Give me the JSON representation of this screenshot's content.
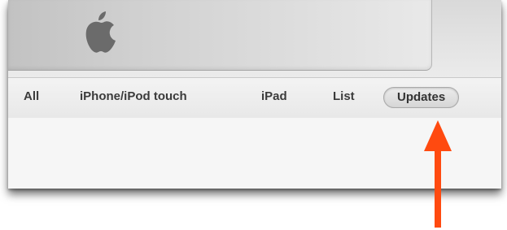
{
  "header": {
    "logo_icon": "apple-logo-icon"
  },
  "tabs": [
    {
      "label": "All"
    },
    {
      "label": "iPhone/iPod touch"
    },
    {
      "label": "iPad"
    },
    {
      "label": "List"
    },
    {
      "label": "Updates",
      "selected": true
    }
  ],
  "annotation": {
    "icon": "arrow-up-icon",
    "color": "#ff4a10"
  }
}
